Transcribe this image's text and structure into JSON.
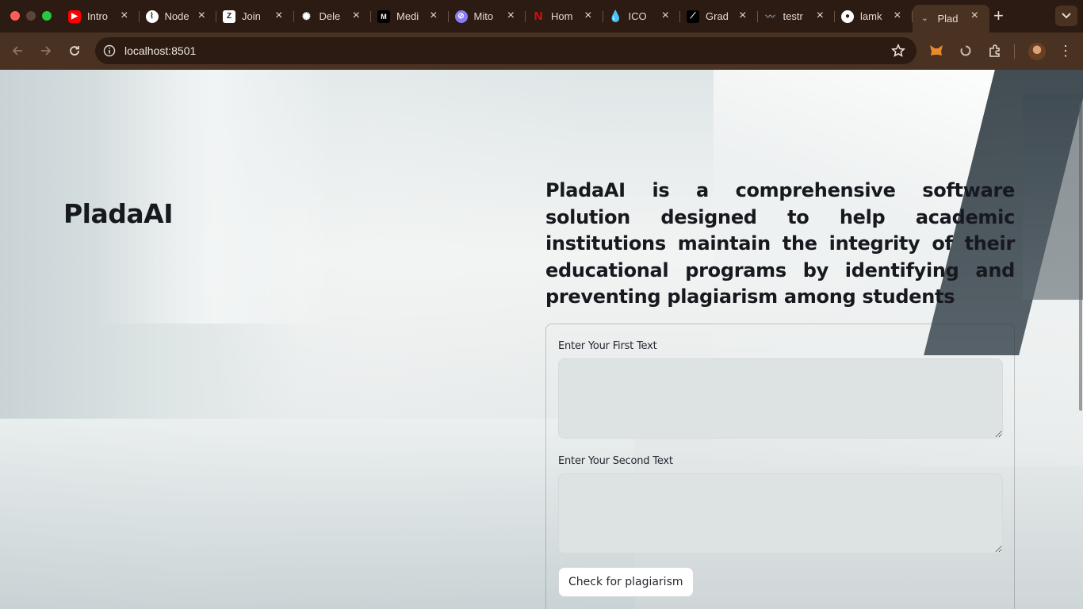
{
  "browser": {
    "tabs": [
      {
        "title": "Intro",
        "favicon": "youtube-icon",
        "color": "#ff0000"
      },
      {
        "title": "Node",
        "favicon": "node-icon",
        "color": "#ffffff"
      },
      {
        "title": "Join",
        "favicon": "zoom-icon",
        "color": "#ffffff"
      },
      {
        "title": "Dele",
        "favicon": "openai-icon",
        "color": "#ffffff"
      },
      {
        "title": "Medi",
        "favicon": "medium-icon",
        "color": "#ffffff"
      },
      {
        "title": "Mito",
        "favicon": "mito-icon",
        "color": "#8a7cf5"
      },
      {
        "title": "Hom",
        "favicon": "netflix-icon",
        "color": "#e50914"
      },
      {
        "title": "ICO",
        "favicon": "drop-icon",
        "color": "#2f7bf5"
      },
      {
        "title": "Grad",
        "favicon": "gradient-icon",
        "color": "#ffffff"
      },
      {
        "title": "testr",
        "favicon": "wave-icon",
        "color": "#7a8a9a"
      },
      {
        "title": "lamk",
        "favicon": "github-icon",
        "color": "#ffffff"
      },
      {
        "title": "Plad",
        "favicon": "streamlit-icon",
        "color": "#b89a88",
        "active": true
      }
    ],
    "address": "localhost:8501"
  },
  "app": {
    "logo_text": "PladaAI",
    "description": "PladaAI is a comprehensive software solution designed to help academic institutions maintain the integrity of their educational programs by identifying and preventing plagiarism among students",
    "form": {
      "first_label": "Enter Your First Text",
      "first_value": "",
      "second_label": "Enter Your Second Text",
      "second_value": "",
      "submit_label": "Check for plagiarism"
    }
  },
  "colors": {
    "tab_strip": "#2b1b12",
    "toolbar": "#4a3222",
    "text": "#17191f",
    "textarea_bg": "#dde2e2"
  }
}
